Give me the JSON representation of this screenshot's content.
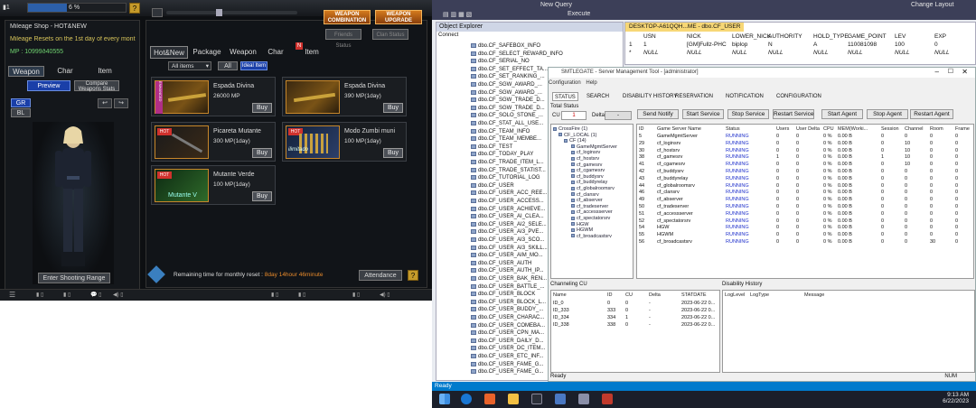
{
  "game": {
    "level_value": "6 %",
    "mileage_shop": "Mileage Shop - HOT&NEW",
    "mileage_reset": "Mileage Resets on the 1st day of every mont",
    "mp_value": "MP : 10999ð40555",
    "left_tabs": [
      "Weapon",
      "Char",
      "Item"
    ],
    "preview": "Preview",
    "compare_stats": "Compare Weapons Stats",
    "gr": "GR",
    "bl": "BL",
    "enter_shooting_range": "Enter Shooting Range",
    "weapon_combination": "WEAPON COMBINATION",
    "weapon_upgrade": "WEAPON UPGRADE",
    "friends_status": "Friends Status",
    "clan_status": "Clan Status",
    "tabs": [
      "Hot&New",
      "Package",
      "Weapon",
      "Char",
      "Item"
    ],
    "tab_badge": "N",
    "filter_select": "All items",
    "filter_all": "All",
    "filter_ideal": "Ideal Item",
    "items": [
      {
        "name": "Espada Divina",
        "price": "26000 MP",
        "buy": "Buy"
      },
      {
        "name": "Espada Divina",
        "price": "390 MP(1day)",
        "buy": "Buy"
      },
      {
        "name": "Picareta Mutante",
        "price": "300 MP(1day)",
        "buy": "Buy"
      },
      {
        "name": "Modo Zumbi muni",
        "price": "100 MP(1day)",
        "buy": "Buy"
      },
      {
        "name": "Mutante Verde",
        "price": "100 MP(1day)",
        "buy": "Buy"
      }
    ],
    "item_badges": [
      "ENHANCED",
      "HOT",
      "HOT",
      "HOT"
    ],
    "item_overlay": "Mutante V",
    "item_overlay2": "ilimitado",
    "remaining_label": "Remaining time for monthly reset :",
    "remaining_value": "8day 14hour 46minute",
    "attendance": "Attendance",
    "help": "?"
  },
  "desktop": {
    "toolbar": {
      "new_query": "New Query",
      "execute": "Execute",
      "change_layout": "Change Layout"
    },
    "object_explorer": {
      "title": "Object Explorer",
      "connect": "Connect",
      "items": [
        "dbo.CF_SAFEBOX_INFO",
        "dbo.CF_SELECT_REWARD_INFO",
        "dbo.CF_SERIAL_NO",
        "dbo.CF_SET_EFFECT_TA...",
        "dbo.CF_SET_RANKING_...",
        "dbo.CF_SGW_AWARD_...",
        "dbo.CF_SGW_AWARD_...",
        "dbo.CF_SGW_TRADE_D...",
        "dbo.CF_SGW_TRADE_D...",
        "dbo.CF_SOLO_STONE_...",
        "dbo.CF_STAT_ALL_USE...",
        "dbo.CF_TEAM_INFO",
        "dbo.CF_TEAM_MEMBE...",
        "dbo.CF_TEST",
        "dbo.CF_TODAY_PLAY",
        "dbo.CF_TRADE_ITEM_L...",
        "dbo.CF_TRADE_STATIST...",
        "dbo.CF_TUTORIAL_LOG",
        "dbo.CF_USER",
        "dbo.CF_USER_ACC_REE...",
        "dbo.CF_USER_ACCESS...",
        "dbo.CF_USER_ACHIEVE...",
        "dbo.CF_USER_AI_CLEA...",
        "dbo.CF_USER_AI2_SELE...",
        "dbo.CF_USER_AI3_PVE...",
        "dbo.CF_USER_AI3_SCO...",
        "dbo.CF_USER_AI3_SKILL...",
        "dbo.CF_USER_AIM_MO...",
        "dbo.CF_USER_AUTH",
        "dbo.CF_USER_AUTH_IP...",
        "dbo.CF_USER_BAK_REN...",
        "dbo.CF_USER_BATTLE_...",
        "dbo.CF_USER_BLOCK",
        "dbo.CF_USER_BLOCK_L...",
        "dbo.CF_USER_BUDDY_...",
        "dbo.CF_USER_CHARAC...",
        "dbo.CF_USER_COMEBA...",
        "dbo.CF_USER_CPN_MA...",
        "dbo.CF_USER_DAILY_D...",
        "dbo.CF_USER_DC_ITEM...",
        "dbo.CF_USER_ETC_INF...",
        "dbo.CF_USER_FAME_G...",
        "dbo.CF_USER_FAME_G..."
      ]
    },
    "query_window": {
      "tab": "DESKTOP-A61QQH...ME - dbo.CF_USER",
      "headers": [
        "USN",
        "NICK",
        "LOWER_NICK",
        "AUTHORITY",
        "HOLD_TYPE",
        "GAME_POINT",
        "LEV",
        "EXP"
      ],
      "row1": [
        "1",
        "[GM]Fullz-PHC",
        "biplop",
        "N",
        "A",
        "110081098",
        "100",
        "0"
      ],
      "row2": [
        "NULL",
        "NULL",
        "NULL",
        "NULL",
        "NULL",
        "NULL",
        "NULL",
        "NULL"
      ],
      "row_numbers": [
        "1",
        "*"
      ]
    },
    "smt": {
      "title": "SMTLEGATE - Server Management Tool - [administrator]",
      "menu": [
        "Configuration",
        "Help"
      ],
      "tabs": [
        "STATUS",
        "SEARCH",
        "DISABILITY HISTORY",
        "RESERVATION",
        "NOTIFICATION",
        "CONFIGURATION"
      ],
      "total_status": "Total Status",
      "cu_label": "CU",
      "cu_value": "1",
      "delta_label": "Delta",
      "delta_value": "-",
      "buttons": [
        "Send Notify",
        "Start Service",
        "Stop Service",
        "Restart Service",
        "Start Agent",
        "Stop Agent",
        "Restart Agent"
      ],
      "tree": [
        "CrossFire (1)",
        "CF_LOCAL (1)",
        "CF (14)",
        "GameMgmtServer",
        "cf_loginsrv",
        "cf_hostsrv",
        "cf_gamesrv",
        "cf_cgamesrv",
        "cf_buddysrv",
        "cf_buddyrelay",
        "cf_globalroomsrv",
        "cf_clansrv",
        "cf_abserver",
        "cf_tradeserver",
        "cf_accessserver",
        "cf_spectatorsrv",
        "HGW",
        "HGWM",
        "cf_broadcastsrv"
      ],
      "grid_headers": [
        "ID",
        "Game Server Name",
        "Status",
        "Users",
        "User Delta",
        "CPU",
        "MEM(Worki...",
        "Session",
        "Channel",
        "Room",
        "Frame"
      ],
      "grid_rows": [
        [
          "5",
          "GameMgmtServer",
          "RUNNING",
          "0",
          "0",
          "0 %",
          "0.00 B",
          "0",
          "0",
          "0",
          "0"
        ],
        [
          "29",
          "cf_loginsrv",
          "RUNNING",
          "0",
          "0",
          "0 %",
          "0.00 B",
          "0",
          "10",
          "0",
          "0"
        ],
        [
          "30",
          "cf_hostsrv",
          "RUNNING",
          "0",
          "0",
          "0 %",
          "0.00 B",
          "0",
          "10",
          "0",
          "0"
        ],
        [
          "38",
          "cf_gamesrv",
          "RUNNING",
          "1",
          "0",
          "0 %",
          "0.00 B",
          "1",
          "10",
          "0",
          "0"
        ],
        [
          "41",
          "cf_cgamesrv",
          "RUNNING",
          "0",
          "0",
          "0 %",
          "0.00 B",
          "0",
          "10",
          "0",
          "0"
        ],
        [
          "42",
          "cf_buddysrv",
          "RUNNING",
          "0",
          "0",
          "0 %",
          "0.00 B",
          "0",
          "0",
          "0",
          "0"
        ],
        [
          "43",
          "cf_buddyrelay",
          "RUNNING",
          "0",
          "0",
          "0 %",
          "0.00 B",
          "0",
          "0",
          "0",
          "0"
        ],
        [
          "44",
          "cf_globalroomsrv",
          "RUNNING",
          "0",
          "0",
          "0 %",
          "0.00 B",
          "0",
          "0",
          "0",
          "0"
        ],
        [
          "46",
          "cf_clansrv",
          "RUNNING",
          "0",
          "0",
          "0 %",
          "0.00 B",
          "0",
          "0",
          "0",
          "0"
        ],
        [
          "49",
          "cf_abserver",
          "RUNNING",
          "0",
          "0",
          "0 %",
          "0.00 B",
          "0",
          "0",
          "0",
          "0"
        ],
        [
          "50",
          "cf_tradeserver",
          "RUNNING",
          "0",
          "0",
          "0 %",
          "0.00 B",
          "0",
          "0",
          "0",
          "0"
        ],
        [
          "51",
          "cf_accessserver",
          "RUNNING",
          "0",
          "0",
          "0 %",
          "0.00 B",
          "0",
          "0",
          "0",
          "0"
        ],
        [
          "52",
          "cf_spectatorsrv",
          "RUNNING",
          "0",
          "0",
          "0 %",
          "0.00 B",
          "0",
          "0",
          "0",
          "0"
        ],
        [
          "54",
          "HGW",
          "RUNNING",
          "0",
          "0",
          "0 %",
          "0.00 B",
          "0",
          "0",
          "0",
          "0"
        ],
        [
          "55",
          "HGWM",
          "RUNNING",
          "0",
          "0",
          "0 %",
          "0.00 B",
          "0",
          "0",
          "0",
          "0"
        ],
        [
          "56",
          "cf_broadcastsrv",
          "RUNNING",
          "0",
          "0",
          "0 %",
          "0.00 B",
          "0",
          "0",
          "30",
          "0"
        ]
      ],
      "channeling_title": "Channeling CU",
      "channeling_headers": [
        "Name",
        "ID",
        "CU",
        "Delta",
        "STATDATE"
      ],
      "channeling_rows": [
        [
          "ID_0",
          "0",
          "0",
          "-",
          "2023-06-22 0..."
        ],
        [
          "ID_333",
          "333",
          "0",
          "-",
          "2023-06-22 0..."
        ],
        [
          "ID_334",
          "334",
          "1",
          "-",
          "2023-06-22 0..."
        ],
        [
          "ID_338",
          "338",
          "0",
          "-",
          "2023-06-22 0..."
        ]
      ],
      "disability_title": "Disability History",
      "disability_headers": [
        "LogLevel",
        "LogType",
        "Message"
      ],
      "ready": "Ready",
      "num": "NUM"
    },
    "status_ready": "Ready",
    "clock_time": "9:13 AM",
    "clock_date": "6/22/2023"
  }
}
